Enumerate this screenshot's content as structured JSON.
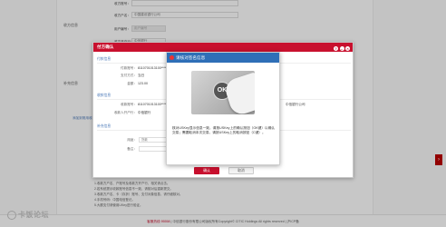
{
  "background": {
    "sections": [
      "收方信息",
      "补充信息"
    ],
    "fields": [
      {
        "label": "收方账号：",
        "value": ""
      },
      {
        "label": "收方户名：",
        "value": "中国建设银行公司"
      },
      {
        "label": "用户编号：",
        "value": "用户编号"
      },
      {
        "label": "收方开户行：",
        "value": "中信银行"
      }
    ],
    "link": "添加到常用收款人",
    "right_value": "中国建设银行公司",
    "notes": [
      "1.收款方户名、户账号及收款方开户行，相关请点击。",
      "2.若系统提示收款账号信息不一致，请核对后重新提交。",
      "3.收款方户名、卡（存折）账号、支付对象信息，请仔细核对。",
      "4.手机号码：中国电信登记。",
      "5.大额支付请使用UKey进行验证。"
    ]
  },
  "pay_dialog": {
    "title": "付方确认",
    "sections": [
      "付款信息",
      "收款信息",
      "补充信息"
    ],
    "rows": [
      {
        "label": "付款账号：",
        "value": "8110701013100****"
      },
      {
        "label": "支付方式：",
        "value": "当日"
      },
      {
        "label": "金额：",
        "value": "123.00"
      },
      {
        "label": "收款账号：",
        "value": "8110701013100****"
      },
      {
        "label": "收款人开户行：",
        "value": "中信银行"
      },
      {
        "label": "用途：",
        "value": "货款"
      },
      {
        "label": "备注：",
        "value": ""
      }
    ],
    "right_value": "中信银行公司",
    "confirm_label": "确认",
    "cancel_label": "取消"
  },
  "ukey_prompt": {
    "title": "请核对签名信息",
    "ok_glyph": "OK",
    "message": "核对USKey显示信息一致，请按USKey上的确认按钮（OK键）以确认交易；需要取消本次交易，请按USKey上的取消按钮（C键）。"
  },
  "footer": {
    "hotline": "客服热线 95558",
    "text": "| 中信银行股份有限公司版权所有Copyright© CITIC Holdings All rights reserved | 沪ICP备"
  },
  "watermark": "卡饭论坛",
  "colors": {
    "brand_red": "#c8102e",
    "prompt_blue": "#2f6fb7"
  }
}
